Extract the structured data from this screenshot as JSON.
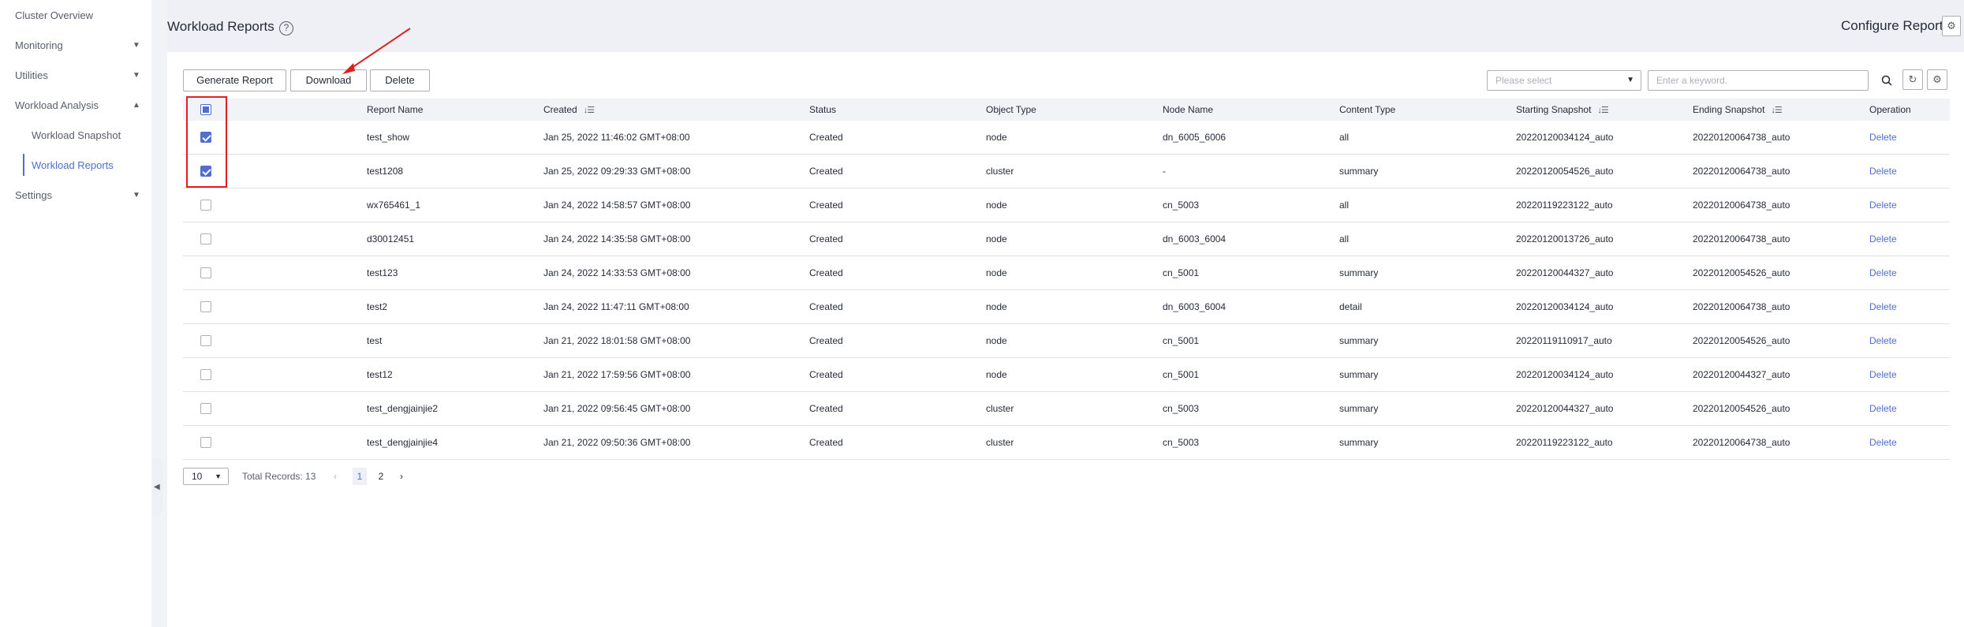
{
  "sidebar": {
    "items": [
      {
        "label": "Cluster Overview"
      },
      {
        "label": "Monitoring"
      },
      {
        "label": "Utilities"
      },
      {
        "label": "Workload Analysis"
      },
      {
        "label": "Settings"
      }
    ],
    "sub_items": [
      {
        "label": "Workload Snapshot",
        "active": false
      },
      {
        "label": "Workload Reports",
        "active": true
      }
    ]
  },
  "header": {
    "title": "Workload Reports",
    "configure_label": "Configure Report"
  },
  "toolbar": {
    "generate_label": "Generate Report",
    "download_label": "Download",
    "delete_label": "Delete",
    "select_placeholder": "Please select",
    "search_placeholder": "Enter a keyword."
  },
  "table": {
    "columns": [
      "Report Name",
      "Created",
      "Status",
      "Object Type",
      "Node Name",
      "Content Type",
      "Starting Snapshot",
      "Ending Snapshot",
      "Operation"
    ],
    "rows": [
      {
        "checked": true,
        "name": "test_show",
        "created": "Jan 25, 2022 11:46:02 GMT+08:00",
        "status": "Created",
        "object": "node",
        "node": "dn_6005_6006",
        "content": "all",
        "start": "20220120034124_auto",
        "end": "20220120064738_auto",
        "op": "Delete"
      },
      {
        "checked": true,
        "name": "test1208",
        "created": "Jan 25, 2022 09:29:33 GMT+08:00",
        "status": "Created",
        "object": "cluster",
        "node": "-",
        "content": "summary",
        "start": "20220120054526_auto",
        "end": "20220120064738_auto",
        "op": "Delete"
      },
      {
        "checked": false,
        "name": "wx765461_1",
        "created": "Jan 24, 2022 14:58:57 GMT+08:00",
        "status": "Created",
        "object": "node",
        "node": "cn_5003",
        "content": "all",
        "start": "20220119223122_auto",
        "end": "20220120064738_auto",
        "op": "Delete"
      },
      {
        "checked": false,
        "name": "d30012451",
        "created": "Jan 24, 2022 14:35:58 GMT+08:00",
        "status": "Created",
        "object": "node",
        "node": "dn_6003_6004",
        "content": "all",
        "start": "20220120013726_auto",
        "end": "20220120064738_auto",
        "op": "Delete"
      },
      {
        "checked": false,
        "name": "test123",
        "created": "Jan 24, 2022 14:33:53 GMT+08:00",
        "status": "Created",
        "object": "node",
        "node": "cn_5001",
        "content": "summary",
        "start": "20220120044327_auto",
        "end": "20220120054526_auto",
        "op": "Delete"
      },
      {
        "checked": false,
        "name": "test2",
        "created": "Jan 24, 2022 11:47:11 GMT+08:00",
        "status": "Created",
        "object": "node",
        "node": "dn_6003_6004",
        "content": "detail",
        "start": "20220120034124_auto",
        "end": "20220120064738_auto",
        "op": "Delete"
      },
      {
        "checked": false,
        "name": "test",
        "created": "Jan 21, 2022 18:01:58 GMT+08:00",
        "status": "Created",
        "object": "node",
        "node": "cn_5001",
        "content": "summary",
        "start": "20220119110917_auto",
        "end": "20220120054526_auto",
        "op": "Delete"
      },
      {
        "checked": false,
        "name": "test12",
        "created": "Jan 21, 2022 17:59:56 GMT+08:00",
        "status": "Created",
        "object": "node",
        "node": "cn_5001",
        "content": "summary",
        "start": "20220120034124_auto",
        "end": "20220120044327_auto",
        "op": "Delete"
      },
      {
        "checked": false,
        "name": "test_dengjainjie2",
        "created": "Jan 21, 2022 09:56:45 GMT+08:00",
        "status": "Created",
        "object": "cluster",
        "node": "cn_5003",
        "content": "summary",
        "start": "20220120044327_auto",
        "end": "20220120054526_auto",
        "op": "Delete"
      },
      {
        "checked": false,
        "name": "test_dengjainjie4",
        "created": "Jan 21, 2022 09:50:36 GMT+08:00",
        "status": "Created",
        "object": "cluster",
        "node": "cn_5003",
        "content": "summary",
        "start": "20220119223122_auto",
        "end": "20220120064738_auto",
        "op": "Delete"
      }
    ]
  },
  "pagination": {
    "page_size": "10",
    "total": "Total Records: 13",
    "pages": [
      "1",
      "2"
    ],
    "current": "1"
  },
  "colors": {
    "accent": "#526ecc",
    "annotation": "#e02020"
  }
}
